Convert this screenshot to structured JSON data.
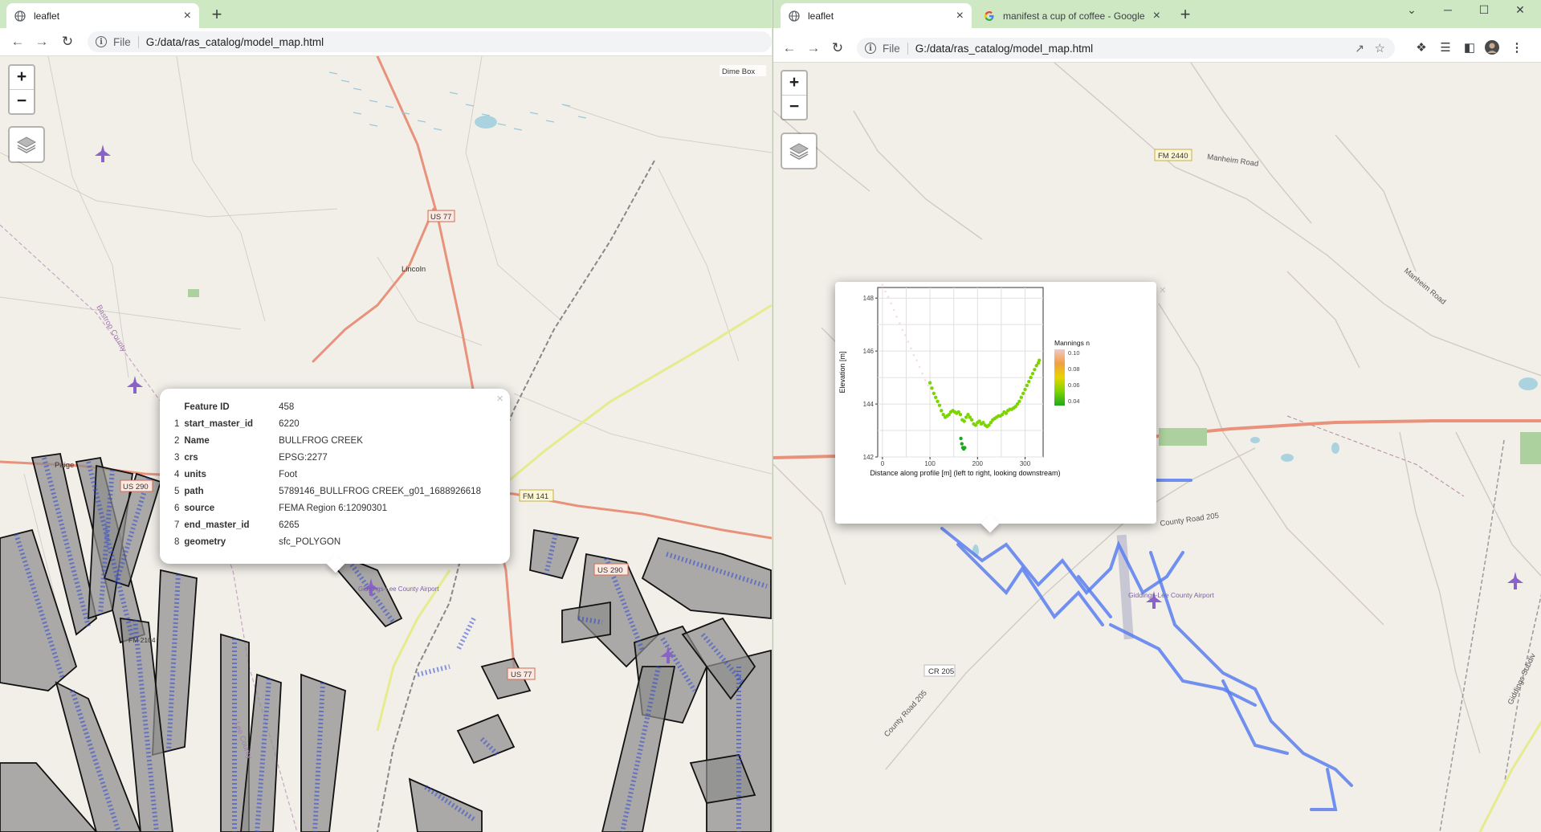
{
  "left_window": {
    "tab": {
      "title": "leaflet",
      "close": "×"
    },
    "new_tab": "+",
    "address": {
      "scheme": "File",
      "url": "G:/data/ras_catalog/model_map.html"
    },
    "zoom": {
      "in": "+",
      "out": "−"
    },
    "map_labels": {
      "dime_box": "Dime Box",
      "us77_north": "US 77",
      "lincoln": "Lincoln",
      "bastrop_county": "Bastrop County",
      "paige": "Paige",
      "us290_west": "US 290",
      "fm141": "FM 141",
      "us290_east": "US 290",
      "giddings_airport": "Giddings-Lee County Airport",
      "us77_south": "US 77",
      "fm2104": "FM 2104",
      "lee_county": "Lee County"
    },
    "popup": {
      "close": "×",
      "header": {
        "key": "Feature ID",
        "value": "458"
      },
      "rows": [
        {
          "num": "1",
          "key": "start_master_id",
          "value": "6220"
        },
        {
          "num": "2",
          "key": "Name",
          "value": "BULLFROG CREEK"
        },
        {
          "num": "3",
          "key": "crs",
          "value": "EPSG:2277"
        },
        {
          "num": "4",
          "key": "units",
          "value": "Foot"
        },
        {
          "num": "5",
          "key": "path",
          "value": "5789146_BULLFROG CREEK_g01_1688926618"
        },
        {
          "num": "6",
          "key": "source",
          "value": "FEMA Region 6:12090301"
        },
        {
          "num": "7",
          "key": "end_master_id",
          "value": "6265"
        },
        {
          "num": "8",
          "key": "geometry",
          "value": "sfc_POLYGON"
        }
      ]
    }
  },
  "right_window": {
    "tabs": [
      {
        "title": "leaflet",
        "close": "×",
        "active": true
      },
      {
        "title": "manifest a cup of coffee - Google",
        "close": "×",
        "active": false
      }
    ],
    "new_tab": "+",
    "window_controls": {
      "minimize": "─",
      "maximize": "☐",
      "close": "✕"
    },
    "address": {
      "scheme": "File",
      "url": "G:/data/ras_catalog/model_map.html"
    },
    "zoom": {
      "in": "+",
      "out": "−"
    },
    "map_labels": {
      "fm2440": "FM 2440",
      "manheim_road": "Manheim Road",
      "manheim_road_2": "Manheim Road",
      "county_road_205": "County Road 205",
      "county_road_205_2": "County Road 205",
      "cr205": "CR 205",
      "giddings_airport": "Giddings-Lee County Airport",
      "giddings_sub": "Giddings Subdiv"
    },
    "popup": {
      "close": "×"
    },
    "chart_data": {
      "type": "scatter",
      "title": "",
      "xlabel": "Distance along profile [m] (left to right, looking downstream)",
      "ylabel": "Elevation [m]",
      "xlim": [
        -10,
        338
      ],
      "ylim": [
        142,
        148.4
      ],
      "x_ticks": [
        0,
        100,
        200,
        300
      ],
      "y_ticks": [
        142,
        144,
        146,
        148
      ],
      "grid": true,
      "legend": {
        "title": "Mannings n",
        "placement": "right",
        "ticks": [
          "0.10",
          "0.08",
          "0.06",
          "0.04"
        ],
        "colors": [
          "#f0c8c8",
          "#f0a040",
          "#e8d400",
          "#7cd400",
          "#1ea81e"
        ]
      },
      "series": [
        {
          "x": [
            0,
            6,
            12,
            18,
            24,
            30,
            36,
            42,
            48,
            54,
            60,
            66,
            72,
            78,
            84,
            90,
            96
          ],
          "y": [
            148.5,
            148.25,
            148.05,
            147.8,
            147.55,
            147.3,
            147.05,
            146.8,
            146.6,
            146.35,
            146.1,
            145.85,
            145.65,
            145.4,
            145.15,
            144.9,
            144.7
          ],
          "n": [
            0.1,
            0.1,
            0.1,
            0.1,
            0.1,
            0.1,
            0.1,
            0.1,
            0.1,
            0.1,
            0.1,
            0.1,
            0.1,
            0.1,
            0.1,
            0.1,
            0.1
          ]
        },
        {
          "x": [
            100,
            104,
            108,
            112,
            116,
            120,
            124,
            128,
            132,
            136,
            140,
            144,
            148,
            152,
            156,
            160,
            164,
            168,
            172,
            176,
            180,
            184,
            188,
            192,
            196,
            200,
            204,
            208,
            212,
            216,
            220,
            224,
            228,
            232,
            236,
            240,
            244,
            248,
            252,
            256,
            260,
            264,
            268,
            272,
            276,
            280,
            284,
            288,
            292,
            296,
            300,
            304,
            308,
            312,
            316,
            320,
            324,
            328,
            330
          ],
          "y": [
            144.8,
            144.6,
            144.4,
            144.25,
            144.1,
            143.95,
            143.75,
            143.6,
            143.5,
            143.55,
            143.6,
            143.7,
            143.75,
            143.7,
            143.65,
            143.7,
            143.6,
            143.4,
            143.35,
            143.5,
            143.6,
            143.5,
            143.4,
            143.25,
            143.2,
            143.3,
            143.35,
            143.25,
            143.3,
            143.2,
            143.15,
            143.2,
            143.3,
            143.4,
            143.45,
            143.5,
            143.55,
            143.55,
            143.6,
            143.7,
            143.65,
            143.75,
            143.8,
            143.8,
            143.85,
            143.9,
            144.0,
            144.1,
            144.25,
            144.4,
            144.55,
            144.7,
            144.85,
            145.0,
            145.15,
            145.3,
            145.45,
            145.55,
            145.65
          ],
          "n": [
            0.055,
            0.05,
            0.05,
            0.05,
            0.05,
            0.05,
            0.05,
            0.05,
            0.05,
            0.05,
            0.05,
            0.05,
            0.05,
            0.05,
            0.05,
            0.05,
            0.05,
            0.05,
            0.05,
            0.05,
            0.05,
            0.05,
            0.05,
            0.05,
            0.05,
            0.05,
            0.05,
            0.05,
            0.05,
            0.05,
            0.05,
            0.05,
            0.05,
            0.05,
            0.05,
            0.05,
            0.05,
            0.05,
            0.05,
            0.05,
            0.05,
            0.05,
            0.05,
            0.05,
            0.05,
            0.05,
            0.05,
            0.05,
            0.05,
            0.05,
            0.05,
            0.05,
            0.05,
            0.05,
            0.05,
            0.055,
            0.055,
            0.055,
            0.055
          ]
        },
        {
          "x": [
            165,
            167,
            169,
            171,
            173
          ],
          "y": [
            142.7,
            142.5,
            142.35,
            142.3,
            142.35
          ],
          "n": [
            0.035,
            0.035,
            0.035,
            0.035,
            0.035
          ]
        }
      ]
    }
  }
}
